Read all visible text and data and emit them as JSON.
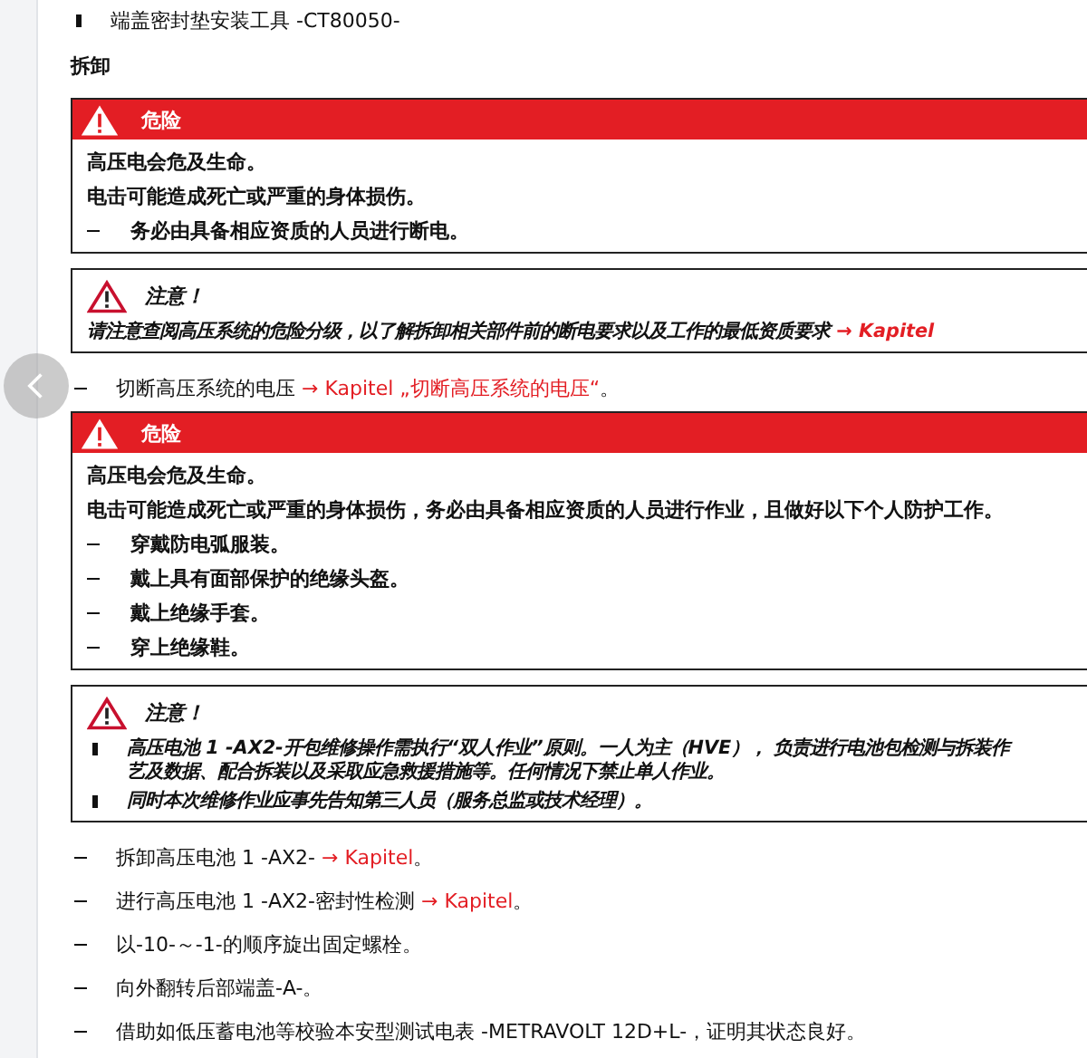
{
  "tool": {
    "text": "端盖密封垫安装工具 -CT80050-"
  },
  "heading": "拆卸",
  "blocks": [
    {
      "kind": "danger",
      "title": "危险",
      "lines": [
        {
          "kind": "plain",
          "text": "高压电会危及生命。"
        },
        {
          "kind": "plain",
          "text": "电击可能造成死亡或严重的身体损伤。"
        },
        {
          "kind": "dash",
          "text": "务必由具备相应资质的人员进行断电。"
        }
      ]
    },
    {
      "kind": "caution",
      "title": "注意！",
      "lines": [
        {
          "kind": "plain",
          "text": "请注意查阅高压系统的危险分级，以了解拆卸相关部件前的断电要求以及工作的最低资质要求 ",
          "link": "→ Kapitel"
        }
      ]
    },
    {
      "kind": "step",
      "text": "切断高压系统的电压 ",
      "link": "→ Kapitel „切断高压系统的电压“",
      "tail": "。"
    },
    {
      "kind": "danger",
      "title": "危险",
      "lines": [
        {
          "kind": "plain",
          "text": "高压电会危及生命。"
        },
        {
          "kind": "plain",
          "text": "电击可能造成死亡或严重的身体损伤，务必由具备相应资质的人员进行作业，且做好以下个人防护工作。"
        },
        {
          "kind": "dash",
          "text": "穿戴防电弧服装。"
        },
        {
          "kind": "dash",
          "text": "戴上具有面部保护的绝缘头盔。"
        },
        {
          "kind": "dash",
          "text": "戴上绝缘手套。"
        },
        {
          "kind": "dash",
          "text": "穿上绝缘鞋。"
        }
      ]
    },
    {
      "kind": "caution",
      "title": "注意！",
      "lines": [
        {
          "kind": "bullet",
          "text": "高压电池 1 -AX2-开包维修操作需执行“双人作业”原则。一人为主（HVE）， 负责进行电池包检测与拆装作",
          "cont": "艺及数据、配合拆装以及采取应急救援措施等。任何情况下禁止单人作业。"
        },
        {
          "kind": "bullet",
          "text": "同时本次维修作业应事先告知第三人员（服务总监或技术经理）。"
        }
      ]
    },
    {
      "kind": "step",
      "text": "拆卸高压电池 1 -AX2- ",
      "link": "→ Kapitel",
      "tail": "。"
    },
    {
      "kind": "step",
      "text": "进行高压电池 1 -AX2-密封性检测 ",
      "link": "→ Kapitel",
      "tail": "。"
    },
    {
      "kind": "step",
      "text": "以-10-～-1-的顺序旋出固定螺栓。"
    },
    {
      "kind": "step",
      "text": "向外翻转后部端盖-A-。"
    },
    {
      "kind": "step",
      "text": "借助如低压蓄电池等校验本安型测试电表 -METRAVOLT 12D+L-，证明其状态良好。"
    }
  ]
}
